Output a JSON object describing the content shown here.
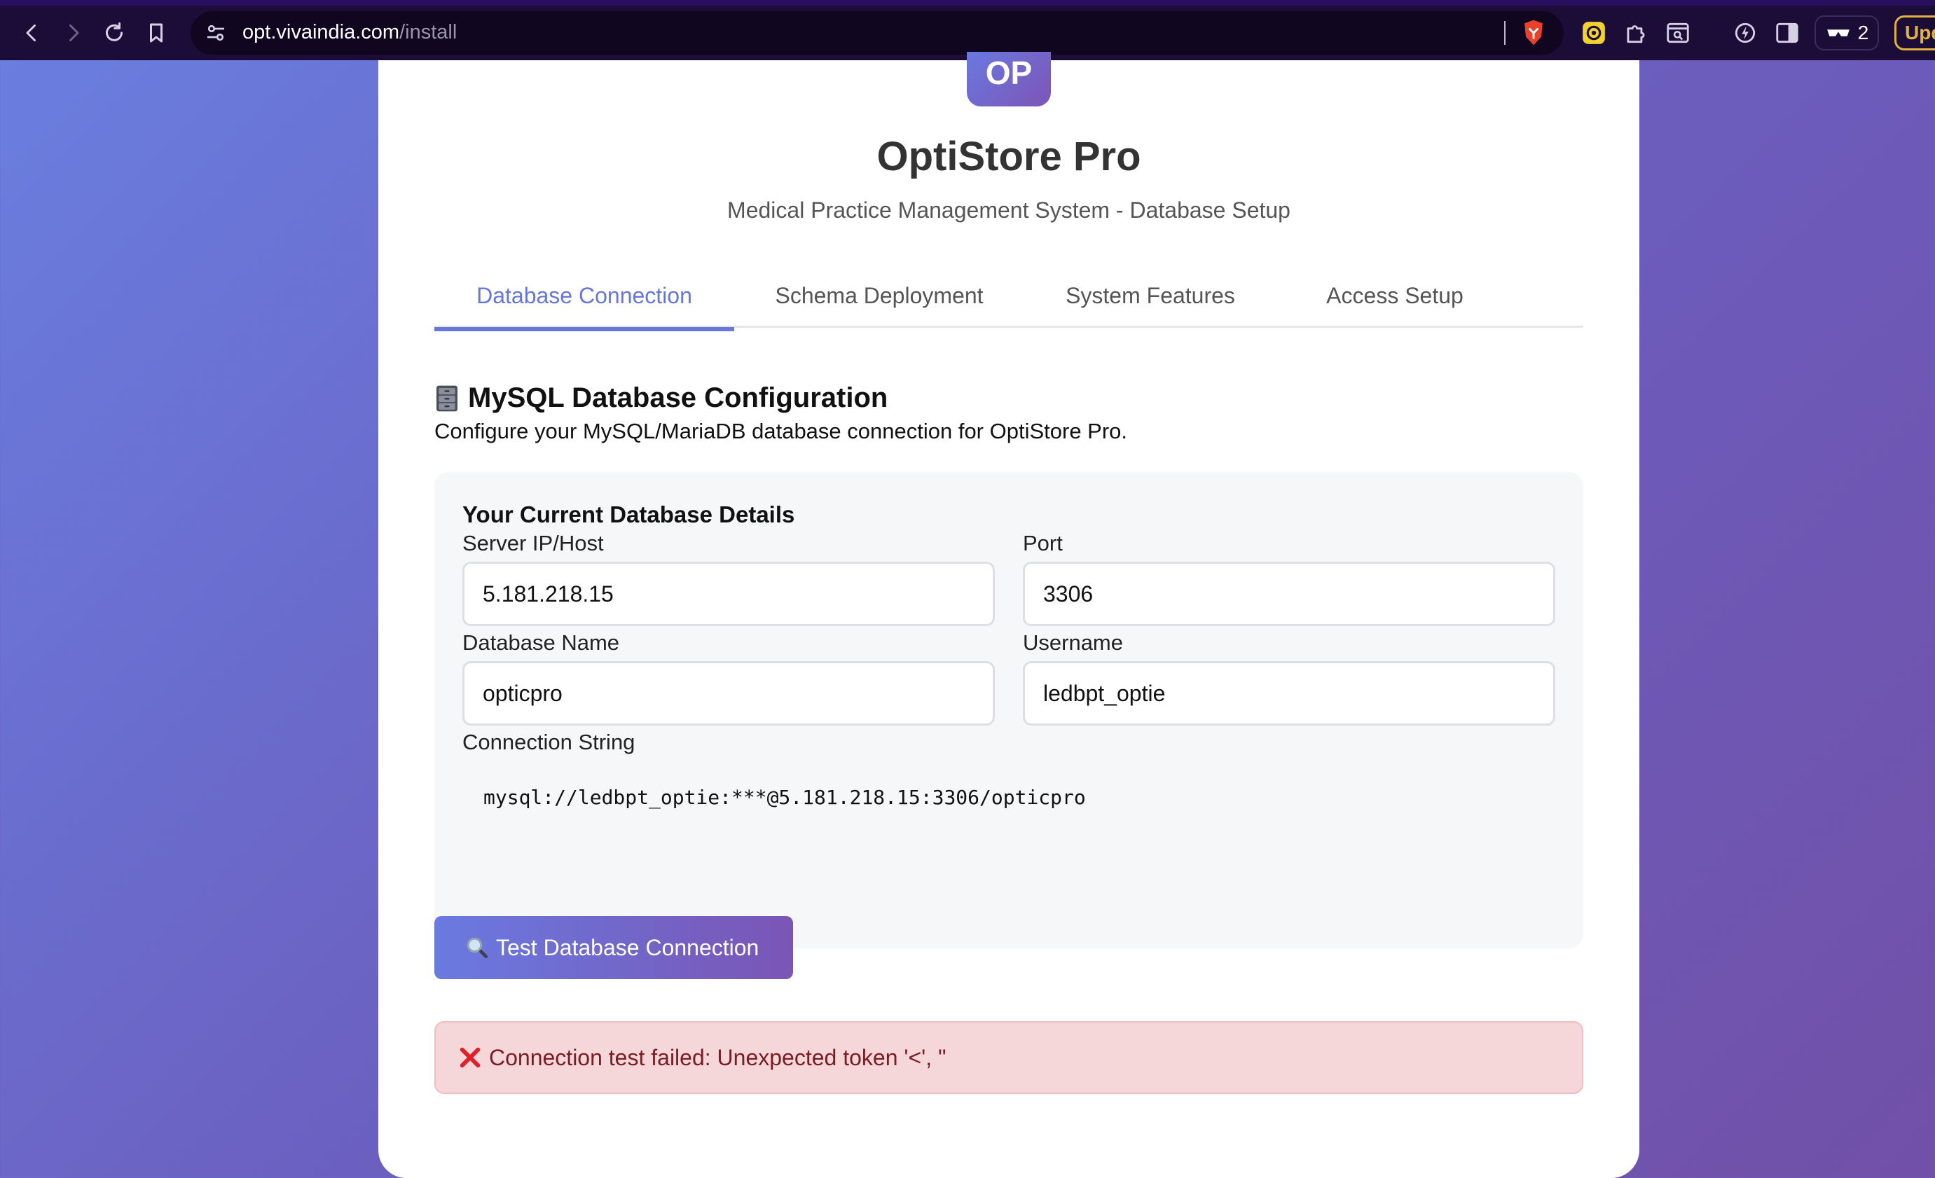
{
  "browser": {
    "url_host": "opt.vivaindia.com",
    "url_path": "/install",
    "tab_count": "2",
    "update_label": "Upd"
  },
  "app": {
    "logo_text": "OP",
    "title": "OptiStore Pro",
    "subtitle": "Medical Practice Management System - Database Setup"
  },
  "tabs": [
    {
      "label": "Database Connection",
      "active": true
    },
    {
      "label": "Schema Deployment",
      "active": false
    },
    {
      "label": "System Features",
      "active": false
    },
    {
      "label": "Access Setup",
      "active": false
    }
  ],
  "section": {
    "heading": "MySQL Database Configuration",
    "description": "Configure your MySQL/MariaDB database connection for OptiStore Pro."
  },
  "details": {
    "title": "Your Current Database Details",
    "server_label": "Server IP/Host",
    "server_value": "5.181.218.15",
    "port_label": "Port",
    "port_value": "3306",
    "dbname_label": "Database Name",
    "dbname_value": "opticpro",
    "username_label": "Username",
    "username_value": "ledbpt_optie",
    "connstring_label": "Connection String",
    "connstring_value": "mysql://ledbpt_optie:***@5.181.218.15:3306/opticpro"
  },
  "actions": {
    "test_button": "Test Database Connection"
  },
  "alert": {
    "message": "Connection test failed: Unexpected token '<', \""
  },
  "colors": {
    "accent": "#6677d9",
    "error_bg": "#f5d6d9",
    "error_text": "#7a1c24"
  }
}
